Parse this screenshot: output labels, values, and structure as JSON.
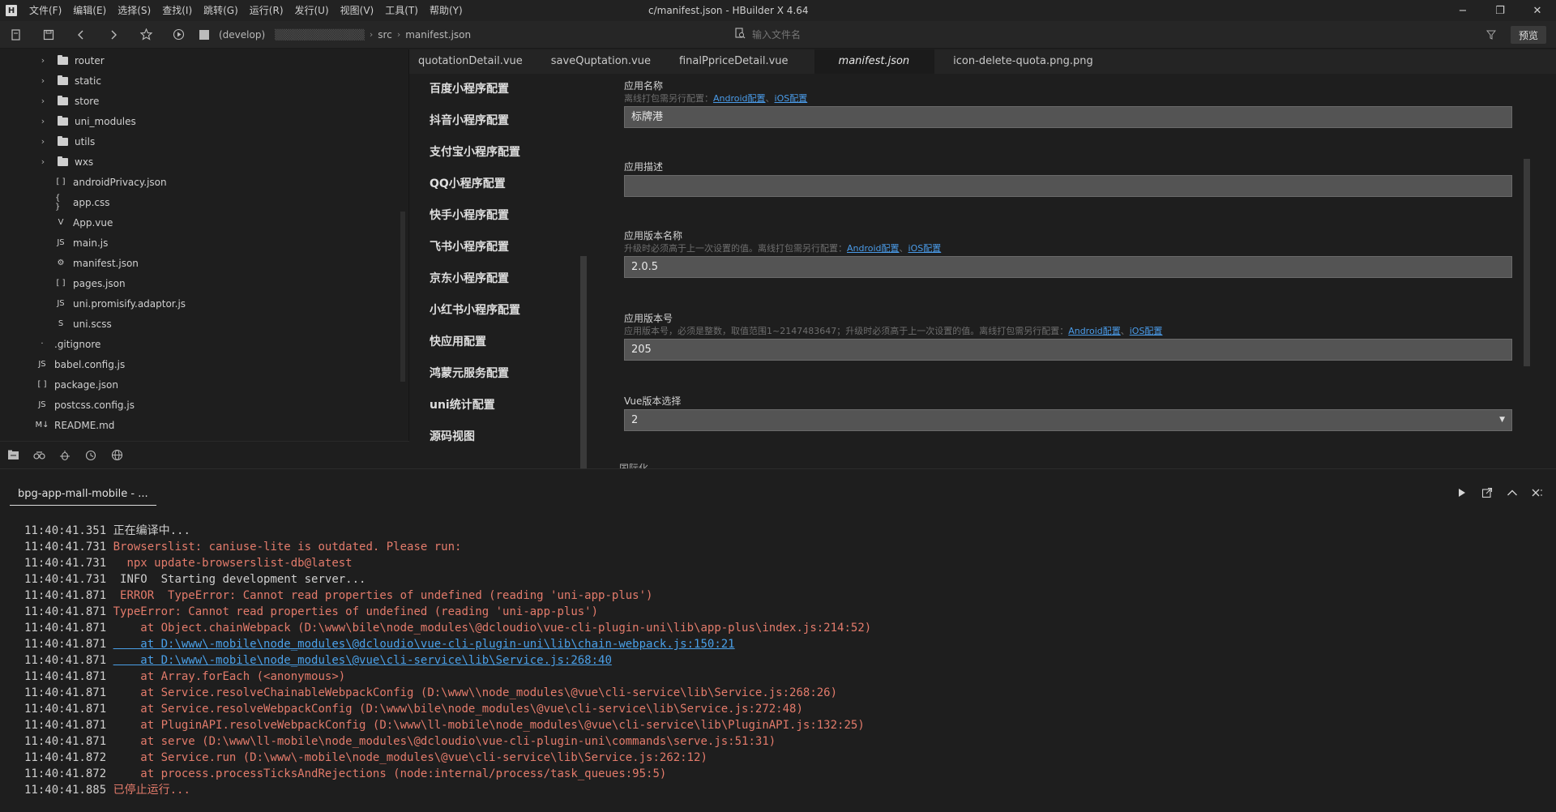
{
  "titlebar": {
    "app_logo": "H",
    "menus": [
      "文件(F)",
      "编辑(E)",
      "选择(S)",
      "查找(I)",
      "跳转(G)",
      "运行(R)",
      "发行(U)",
      "视图(V)",
      "工具(T)",
      "帮助(Y)"
    ],
    "window_title": "c/manifest.json - HBuilder X 4.64",
    "controls": {
      "minimize": "−",
      "restore": "❐",
      "close": "✕"
    }
  },
  "toolbar": {
    "icons": [
      "new-file-icon",
      "save-icon",
      "back-icon",
      "forward-icon",
      "favorite-icon",
      "run-icon"
    ],
    "breadcrumb": [
      "(develop)",
      "src",
      "manifest.json"
    ],
    "search_placeholder": "输入文件名",
    "preview_label": "预览"
  },
  "sidebar": {
    "items": [
      {
        "type": "folder",
        "label": "router",
        "indent": 1
      },
      {
        "type": "folder",
        "label": "static",
        "indent": 1
      },
      {
        "type": "folder",
        "label": "store",
        "indent": 1
      },
      {
        "type": "folder",
        "label": "uni_modules",
        "indent": 1
      },
      {
        "type": "folder",
        "label": "utils",
        "indent": 1
      },
      {
        "type": "folder",
        "label": "wxs",
        "indent": 1
      },
      {
        "type": "json",
        "label": "androidPrivacy.json",
        "indent": 1
      },
      {
        "type": "css",
        "label": "app.css",
        "indent": 1
      },
      {
        "type": "vue",
        "label": "App.vue",
        "indent": 1
      },
      {
        "type": "js",
        "label": "main.js",
        "indent": 1
      },
      {
        "type": "manifest",
        "label": "manifest.json",
        "indent": 1
      },
      {
        "type": "json",
        "label": "pages.json",
        "indent": 1
      },
      {
        "type": "js",
        "label": "uni.promisify.adaptor.js",
        "indent": 1
      },
      {
        "type": "scss",
        "label": "uni.scss",
        "indent": 1
      },
      {
        "type": "file",
        "label": ".gitignore",
        "indent": 0
      },
      {
        "type": "js",
        "label": "babel.config.js",
        "indent": 0
      },
      {
        "type": "json",
        "label": "package.json",
        "indent": 0
      },
      {
        "type": "js",
        "label": "postcss.config.js",
        "indent": 0
      },
      {
        "type": "md",
        "label": "README.md",
        "indent": 0
      }
    ],
    "bottom_tools": [
      "project-manager-icon",
      "plugin-icon",
      "debug-icon",
      "git-icon",
      "web-icon"
    ]
  },
  "editor_tabs": [
    {
      "label": "quotationDetail.vue",
      "active": false
    },
    {
      "label": "saveQuptation.vue",
      "active": false
    },
    {
      "label": "finalPpriceDetail.vue",
      "active": false
    },
    {
      "label": "manifest.json",
      "active": true
    },
    {
      "label": "icon-delete-quota.png.png",
      "active": false
    }
  ],
  "manifest_nav": [
    "百度小程序配置",
    "抖音小程序配置",
    "支付宝小程序配置",
    "QQ小程序配置",
    "快手小程序配置",
    "飞书小程序配置",
    "京东小程序配置",
    "小红书小程序配置",
    "快应用配置",
    "鸿蒙元服务配置",
    "uni统计配置",
    "源码视图"
  ],
  "form": {
    "app_name": {
      "label": "应用名称",
      "hint": "离线打包需另行配置：",
      "link_android": "Android配置",
      "link_sep": "、",
      "link_ios": "iOS配置",
      "value": "标牌港"
    },
    "app_desc": {
      "label": "应用描述",
      "value": ""
    },
    "version_name": {
      "label": "应用版本名称",
      "hint": "升级时必须高于上一次设置的值。离线打包需另行配置：",
      "link_android": "Android配置",
      "link_sep": "、",
      "link_ios": "iOS配置",
      "value": "2.0.5"
    },
    "version_code": {
      "label": "应用版本号",
      "hint": "应用版本号，必须是整数，取值范围1~2147483647；升级时必须高于上一次设置的值。离线打包需另行配置：",
      "link_android": "Android配置",
      "link_sep": "、",
      "link_ios": "iOS配置",
      "value": "205"
    },
    "vue_version": {
      "label": "Vue版本选择",
      "value": "2"
    },
    "next_section": "国际化"
  },
  "console": {
    "tab_label": "bpg-app-mall-mobile - ...",
    "actions": [
      "run-icon",
      "open-external-icon",
      "collapse-icon",
      "clear-close-icon"
    ],
    "lines": [
      {
        "ts": "11:40:41.351",
        "msg": "正在编译中...",
        "style": "normal"
      },
      {
        "ts": "11:40:41.731",
        "msg": "Browserslist: caniuse-lite is outdated. Please run:",
        "style": "red"
      },
      {
        "ts": "11:40:41.731",
        "msg": "  npx update-browserslist-db@latest",
        "style": "red"
      },
      {
        "ts": "11:40:41.731",
        "msg": " INFO  Starting development server...",
        "style": "normal"
      },
      {
        "ts": "11:40:41.871",
        "msg": " ERROR  TypeError: Cannot read properties of undefined (reading 'uni-app-plus')",
        "style": "red"
      },
      {
        "ts": "11:40:41.871",
        "msg": "TypeError: Cannot read properties of undefined (reading 'uni-app-plus')",
        "style": "red"
      },
      {
        "ts": "11:40:41.871",
        "msg": "    at Object.chainWebpack (D:\\www\\bile\\node_modules\\@dcloudio\\vue-cli-plugin-uni\\lib\\app-plus\\index.js:214:52)",
        "style": "red"
      },
      {
        "ts": "11:40:41.871",
        "msg": "    at D:\\www\\-mobile\\node_modules\\@dcloudio\\vue-cli-plugin-uni\\lib\\chain-webpack.js:150:21",
        "style": "link"
      },
      {
        "ts": "11:40:41.871",
        "msg": "    at D:\\www\\-mobile\\node_modules\\@vue\\cli-service\\lib\\Service.js:268:40",
        "style": "link"
      },
      {
        "ts": "11:40:41.871",
        "msg": "    at Array.forEach (<anonymous>)",
        "style": "red"
      },
      {
        "ts": "11:40:41.871",
        "msg": "    at Service.resolveChainableWebpackConfig (D:\\www\\\\node_modules\\@vue\\cli-service\\lib\\Service.js:268:26)",
        "style": "red"
      },
      {
        "ts": "11:40:41.871",
        "msg": "    at Service.resolveWebpackConfig (D:\\www\\bile\\node_modules\\@vue\\cli-service\\lib\\Service.js:272:48)",
        "style": "red"
      },
      {
        "ts": "11:40:41.871",
        "msg": "    at PluginAPI.resolveWebpackConfig (D:\\www\\ll-mobile\\node_modules\\@vue\\cli-service\\lib\\PluginAPI.js:132:25)",
        "style": "red"
      },
      {
        "ts": "11:40:41.871",
        "msg": "    at serve (D:\\www\\ll-mobile\\node_modules\\@dcloudio\\vue-cli-plugin-uni\\commands\\serve.js:51:31)",
        "style": "red"
      },
      {
        "ts": "11:40:41.872",
        "msg": "    at Service.run (D:\\www\\-mobile\\node_modules\\@vue\\cli-service\\lib\\Service.js:262:12)",
        "style": "red"
      },
      {
        "ts": "11:40:41.872",
        "msg": "    at process.processTicksAndRejections (node:internal/process/task_queues:95:5)",
        "style": "red"
      },
      {
        "ts": "11:40:41.885",
        "msg": "已停止运行...",
        "style": "red"
      }
    ]
  },
  "colors": {
    "background": "#1e1e1e",
    "error_red": "#e37b6b",
    "link_blue": "#4aa0e8",
    "input_bg": "#545454"
  }
}
